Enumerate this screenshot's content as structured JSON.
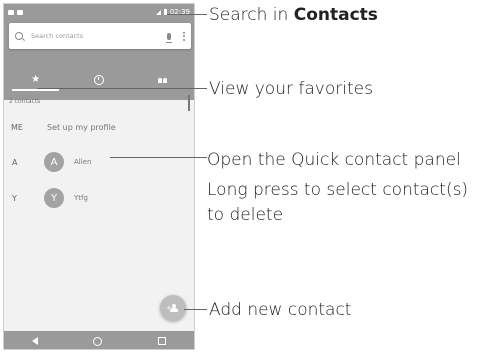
{
  "status_bar": {
    "time": "02:39"
  },
  "search": {
    "placeholder": "Search contacts"
  },
  "tabs": [
    {
      "name": "favorites",
      "icon": "star-icon"
    },
    {
      "name": "recent",
      "icon": "clock-icon"
    },
    {
      "name": "all-contacts",
      "icon": "group-icon"
    }
  ],
  "contacts": {
    "count_label": "2 contacts",
    "me_label": "ME",
    "profile_label": "Set up my profile",
    "items": [
      {
        "section": "A",
        "initial": "A",
        "name": "Allen"
      },
      {
        "section": "Y",
        "initial": "Y",
        "name": "Ytfg"
      }
    ]
  },
  "callouts": {
    "search": {
      "prefix": "Search in ",
      "bold": "Contacts"
    },
    "favorites": "View your favorites",
    "quick_contact_line1": "Open the Quick contact panel",
    "quick_contact_line2": "Long press to select contact(s)",
    "quick_contact_line3": "to delete",
    "add_contact": "Add new contact"
  },
  "colors": {
    "header": "#9a9a9a",
    "avatar": "#a3a3a3",
    "fab": "#bdbdbd"
  }
}
